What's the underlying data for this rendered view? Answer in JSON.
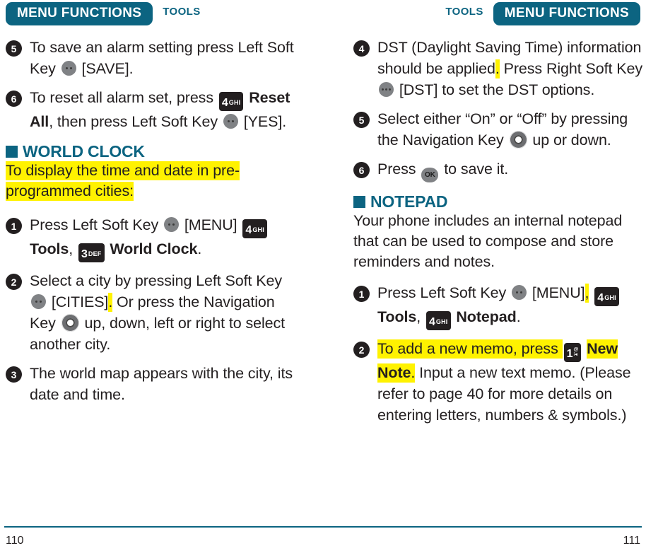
{
  "header": {
    "left": {
      "pill": "MENU FUNCTIONS",
      "chapter": "TOOLS"
    },
    "right": {
      "pill": "MENU FUNCTIONS",
      "chapter": "TOOLS"
    }
  },
  "colors": {
    "accent_teal": "#0c6481",
    "highlight_yellow": "#fff200",
    "key_dark": "#231f20",
    "softkey_gray": "#808285"
  },
  "left_column": {
    "steps_top": [
      {
        "number": "5",
        "parts": [
          {
            "t": "To save an alarm setting press Left Soft Key "
          },
          {
            "icon": "left-soft-key",
            "dots": 2
          },
          {
            "t": " [SAVE]."
          }
        ]
      },
      {
        "number": "6",
        "parts": [
          {
            "t": "To reset all alarm set, press "
          },
          {
            "icon": "num-key",
            "digit": "4",
            "letters": "GHI"
          },
          {
            "t": " "
          },
          {
            "t": "Reset All",
            "bold": true
          },
          {
            "t": ", then press Left Soft Key "
          },
          {
            "icon": "left-soft-key",
            "dots": 2
          },
          {
            "t": " [YES]."
          }
        ]
      }
    ],
    "section": {
      "title": "WORLD CLOCK",
      "intro": "To display the time and date in pre-programmed cities:",
      "intro_highlighted": true,
      "steps": [
        {
          "number": "1",
          "parts": [
            {
              "t": "Press Left Soft Key "
            },
            {
              "icon": "left-soft-key",
              "dots": 2
            },
            {
              "t": " [MENU] "
            },
            {
              "icon": "num-key",
              "digit": "4",
              "letters": "GHI"
            },
            {
              "t": " "
            },
            {
              "t": "Tools",
              "bold": true
            },
            {
              "t": ", "
            },
            {
              "icon": "num-key",
              "digit": "3",
              "letters": "DEF"
            },
            {
              "t": " "
            },
            {
              "t": "World Clock",
              "bold": true
            },
            {
              "t": "."
            }
          ]
        },
        {
          "number": "2",
          "parts": [
            {
              "t": "Select a city by pressing Left Soft Key "
            },
            {
              "icon": "left-soft-key",
              "dots": 2
            },
            {
              "t": " [CITIES]"
            },
            {
              "t": ".",
              "hl": true
            },
            {
              "t": " Or press the Navigation Key "
            },
            {
              "icon": "navigation-key"
            },
            {
              "t": " up, down, left or right to select another city."
            }
          ]
        },
        {
          "number": "3",
          "parts": [
            {
              "t": "The world map appears with the city, its date and time."
            }
          ]
        }
      ]
    }
  },
  "right_column": {
    "steps_top": [
      {
        "number": "4",
        "parts": [
          {
            "t": "DST (Daylight Saving Time) information should be applied"
          },
          {
            "t": ".",
            "hl": true
          },
          {
            "t": " Press Right Soft Key "
          },
          {
            "icon": "right-soft-key",
            "dots": 3
          },
          {
            "t": " [DST] to set the DST options."
          }
        ]
      },
      {
        "number": "5",
        "parts": [
          {
            "t": "Select either “On” or “Off” by pressing the Navigation Key "
          },
          {
            "icon": "navigation-key"
          },
          {
            "t": " up or down."
          }
        ]
      },
      {
        "number": "6",
        "parts": [
          {
            "t": "Press "
          },
          {
            "icon": "ok-key",
            "label": "OK"
          },
          {
            "t": " to save it."
          }
        ]
      }
    ],
    "section": {
      "title": "NOTEPAD",
      "intro": "Your phone includes an internal notepad that can be used to compose and store reminders and notes.",
      "intro_highlighted": false,
      "steps": [
        {
          "number": "1",
          "parts": [
            {
              "t": "Press Left Soft Key "
            },
            {
              "icon": "left-soft-key",
              "dots": 2
            },
            {
              "t": " [MENU]"
            },
            {
              "t": ",",
              "hl": true
            },
            {
              "t": " "
            },
            {
              "icon": "num-key",
              "digit": "4",
              "letters": "GHI"
            },
            {
              "t": " "
            },
            {
              "t": "Tools",
              "bold": true
            },
            {
              "t": ", "
            },
            {
              "icon": "num-key",
              "digit": "4",
              "letters": "GHI"
            },
            {
              "t": " "
            },
            {
              "t": "Notepad",
              "bold": true
            },
            {
              "t": "."
            }
          ]
        },
        {
          "number": "2",
          "parts": [
            {
              "t": "To add a new memo, press ",
              "hl": true
            },
            {
              "icon": "num-key-1",
              "digit": "1",
              "sym_top": "@",
              "sym_bottom": "∶◂"
            },
            {
              "t": " "
            },
            {
              "t": "New Note",
              "bold": true,
              "hl": true
            },
            {
              "t": ".",
              "hl": true
            },
            {
              "t": " Input a new text memo. (Please refer to page 40 for more details on entering letters, numbers & symbols.)"
            }
          ]
        }
      ]
    }
  },
  "footer": {
    "page_left": "110",
    "page_right": "111"
  }
}
